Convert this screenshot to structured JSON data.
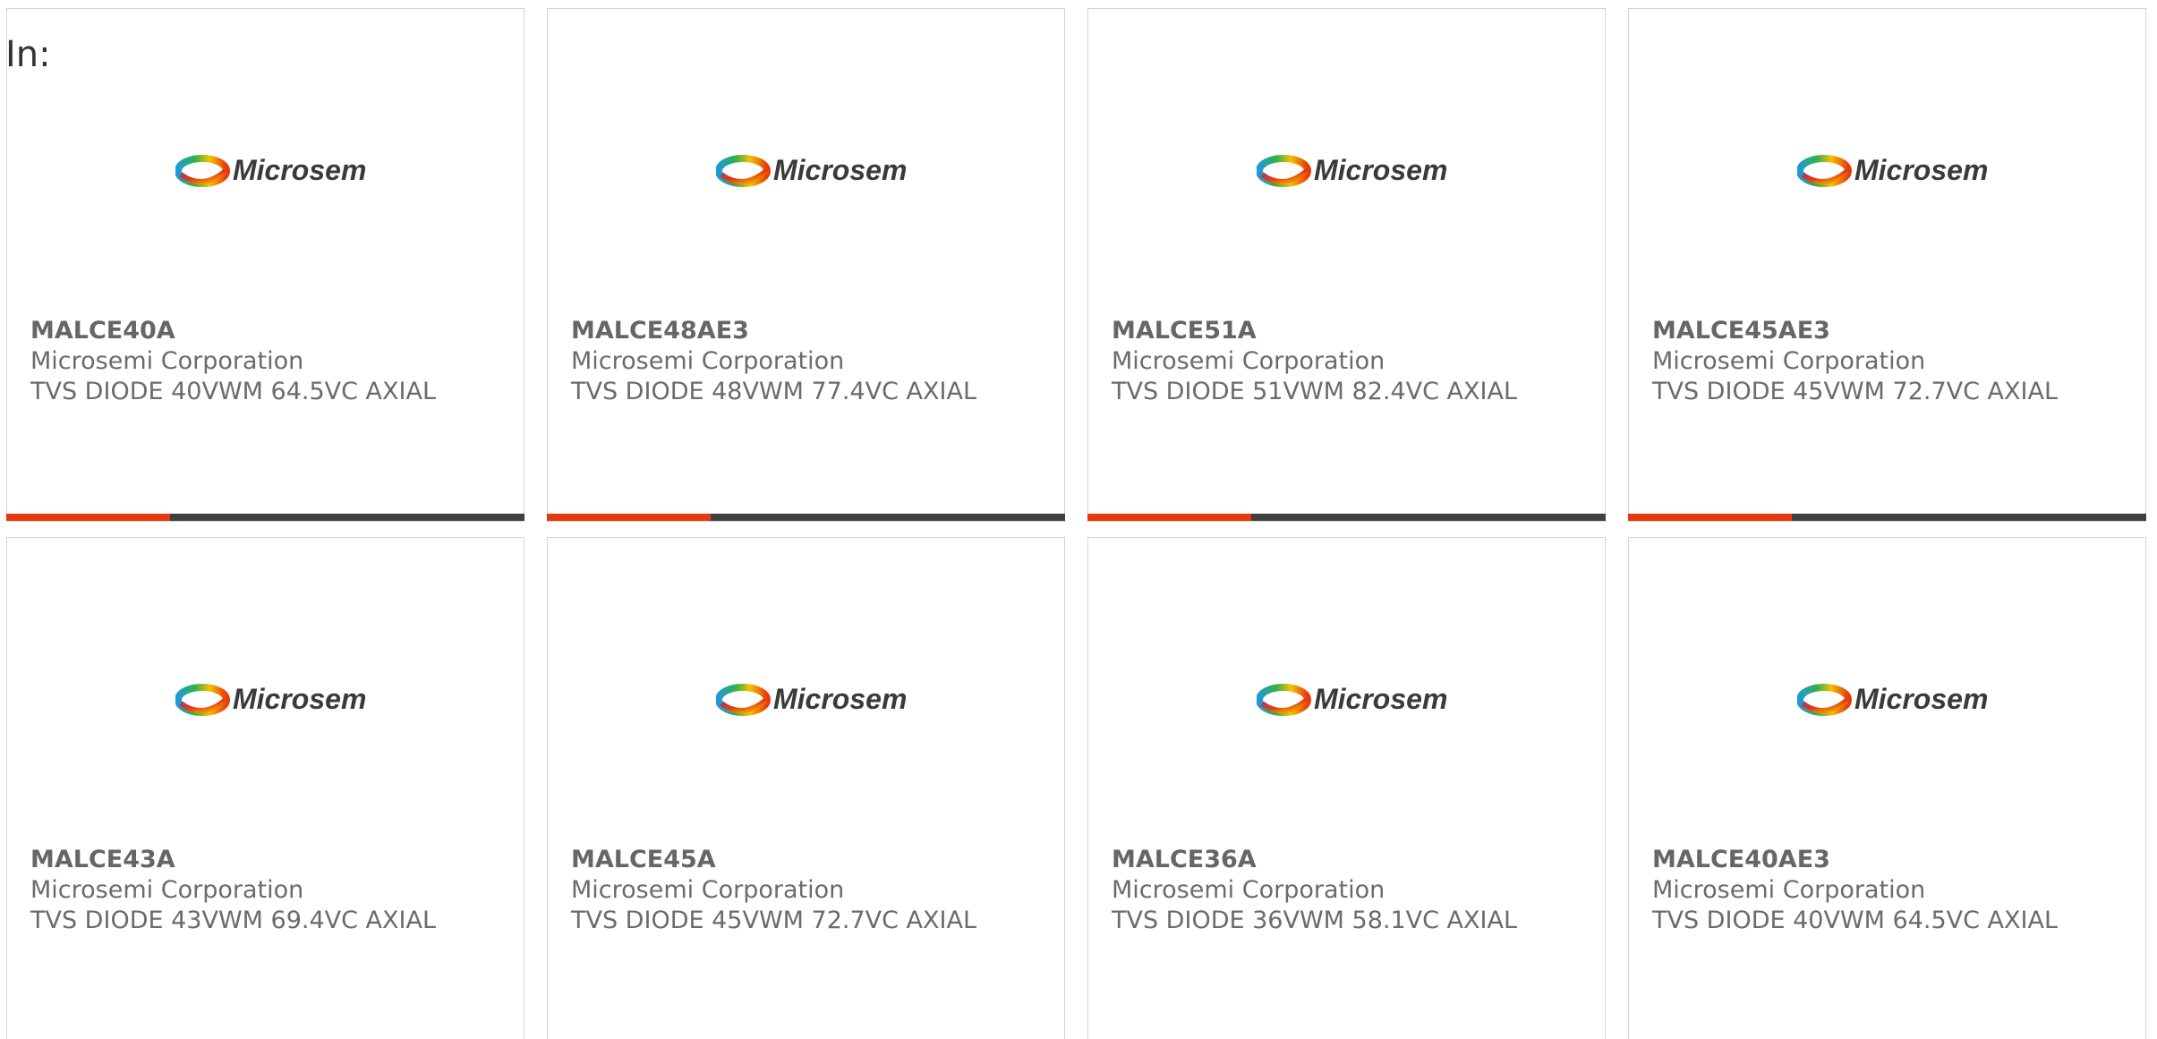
{
  "filter": {
    "label": "In:"
  },
  "brand": {
    "logo_text": "Microsemi",
    "accent_color": "#e8380d",
    "bar_color": "#3e3f40"
  },
  "products": [
    {
      "part": "MALCE40A",
      "manufacturer": "Microsemi Corporation",
      "description": "TVS DIODE 40VWM 64.5VC AXIAL"
    },
    {
      "part": "MALCE48AE3",
      "manufacturer": "Microsemi Corporation",
      "description": "TVS DIODE 48VWM 77.4VC AXIAL"
    },
    {
      "part": "MALCE51A",
      "manufacturer": "Microsemi Corporation",
      "description": "TVS DIODE 51VWM 82.4VC AXIAL"
    },
    {
      "part": "MALCE45AE3",
      "manufacturer": "Microsemi Corporation",
      "description": "TVS DIODE 45VWM 72.7VC AXIAL"
    },
    {
      "part": "MALCE43A",
      "manufacturer": "Microsemi Corporation",
      "description": "TVS DIODE 43VWM 69.4VC AXIAL"
    },
    {
      "part": "MALCE45A",
      "manufacturer": "Microsemi Corporation",
      "description": "TVS DIODE 45VWM 72.7VC AXIAL"
    },
    {
      "part": "MALCE36A",
      "manufacturer": "Microsemi Corporation",
      "description": "TVS DIODE 36VWM 58.1VC AXIAL"
    },
    {
      "part": "MALCE40AE3",
      "manufacturer": "Microsemi Corporation",
      "description": "TVS DIODE 40VWM 64.5VC AXIAL"
    }
  ]
}
